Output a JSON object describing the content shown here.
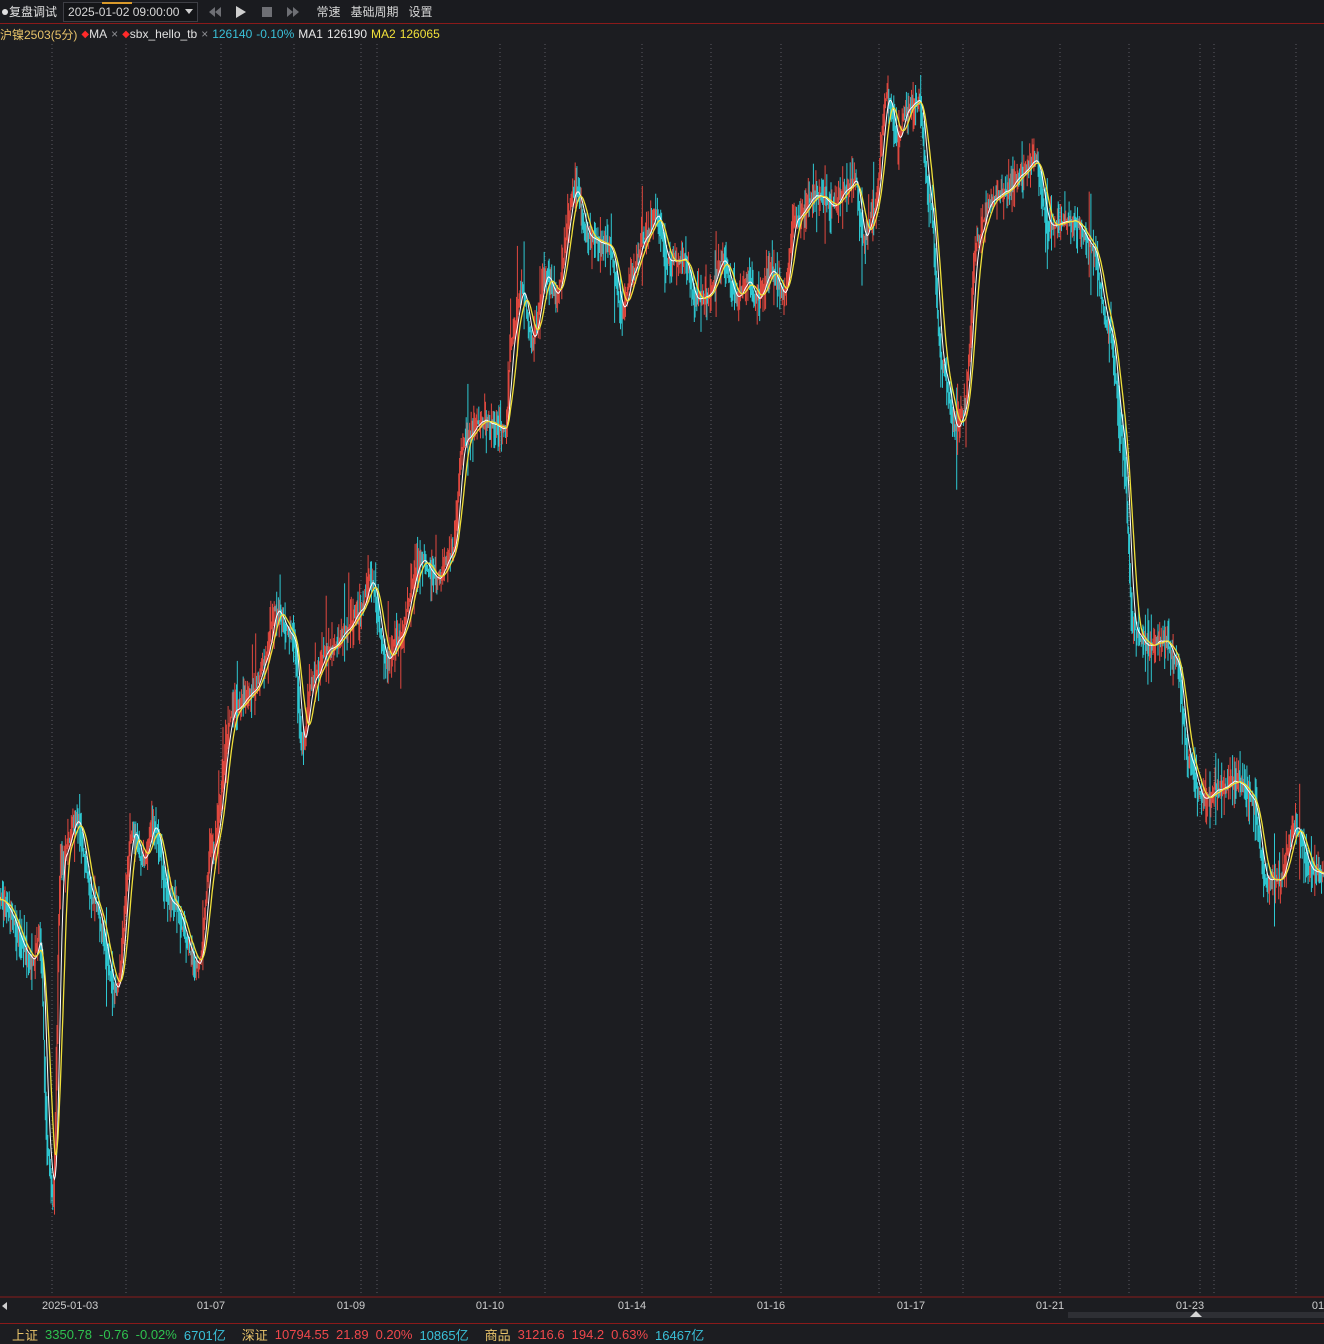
{
  "toolbar": {
    "title": "复盘调试",
    "datetime": "2025-01-02 09:00:00",
    "speed_label": "常速",
    "period_label": "基础周期",
    "settings_label": "设置"
  },
  "legend": {
    "symbol": "沪镍2503(5分)",
    "indicator1": "MA",
    "indicator2": "sbx_hello_tb",
    "close_symbol": "×",
    "price": "126140",
    "change_pct": "-0.10%",
    "ma1_label": "MA1",
    "ma1_value": "126190",
    "ma2_label": "MA2",
    "ma2_value": "126065"
  },
  "colors": {
    "up": "#e0483f",
    "down": "#2ec8d2",
    "ma1": "#ffffff",
    "ma2": "#f0e03a",
    "grid": "#5b5c62",
    "status_green": "#2fc24f",
    "status_red": "#f0484c",
    "status_cyan": "#3ac0d8"
  },
  "xaxis": {
    "ticks": [
      {
        "label": "2025-01-03",
        "at": 0.032
      },
      {
        "label": "01-07",
        "at": 0.159
      },
      {
        "label": "01-09",
        "at": 0.265
      },
      {
        "label": "01-10",
        "at": 0.37
      },
      {
        "label": "01-14",
        "at": 0.477
      },
      {
        "label": "01-16",
        "at": 0.582
      },
      {
        "label": "01-17",
        "at": 0.688
      },
      {
        "label": "01-21",
        "at": 0.793
      },
      {
        "label": "01-23",
        "at": 0.899
      },
      {
        "label": "01",
        "at": 1.0
      }
    ]
  },
  "chart_data": {
    "type": "line",
    "bars": 1580,
    "series": [
      {
        "anchors": [
          [
            0.0,
            900
          ],
          [
            0.025,
            960
          ],
          [
            0.03,
            935
          ],
          [
            0.036,
            1150
          ],
          [
            0.04,
            1200
          ],
          [
            0.046,
            860
          ],
          [
            0.058,
            820
          ],
          [
            0.07,
            900
          ],
          [
            0.088,
            990
          ],
          [
            0.1,
            830
          ],
          [
            0.108,
            860
          ],
          [
            0.116,
            825
          ],
          [
            0.128,
            900
          ],
          [
            0.15,
            965
          ],
          [
            0.16,
            850
          ],
          [
            0.176,
            710
          ],
          [
            0.192,
            690
          ],
          [
            0.2,
            660
          ],
          [
            0.208,
            610
          ],
          [
            0.222,
            640
          ],
          [
            0.228,
            745
          ],
          [
            0.236,
            680
          ],
          [
            0.248,
            650
          ],
          [
            0.262,
            630
          ],
          [
            0.272,
            610
          ],
          [
            0.28,
            580
          ],
          [
            0.292,
            660
          ],
          [
            0.3,
            640
          ],
          [
            0.318,
            560
          ],
          [
            0.33,
            580
          ],
          [
            0.342,
            550
          ],
          [
            0.35,
            440
          ],
          [
            0.364,
            420
          ],
          [
            0.382,
            430
          ],
          [
            0.386,
            340
          ],
          [
            0.394,
            290
          ],
          [
            0.402,
            340
          ],
          [
            0.412,
            275
          ],
          [
            0.42,
            295
          ],
          [
            0.434,
            190
          ],
          [
            0.446,
            240
          ],
          [
            0.46,
            245
          ],
          [
            0.47,
            310
          ],
          [
            0.478,
            270
          ],
          [
            0.486,
            240
          ],
          [
            0.496,
            215
          ],
          [
            0.504,
            262
          ],
          [
            0.516,
            260
          ],
          [
            0.526,
            300
          ],
          [
            0.534,
            295
          ],
          [
            0.546,
            260
          ],
          [
            0.556,
            300
          ],
          [
            0.564,
            280
          ],
          [
            0.572,
            300
          ],
          [
            0.582,
            270
          ],
          [
            0.592,
            295
          ],
          [
            0.6,
            220
          ],
          [
            0.616,
            195
          ],
          [
            0.63,
            205
          ],
          [
            0.638,
            190
          ],
          [
            0.646,
            180
          ],
          [
            0.652,
            240
          ],
          [
            0.66,
            210
          ],
          [
            0.67,
            95
          ],
          [
            0.678,
            140
          ],
          [
            0.684,
            110
          ],
          [
            0.694,
            100
          ],
          [
            0.702,
            200
          ],
          [
            0.712,
            370
          ],
          [
            0.722,
            430
          ],
          [
            0.728,
            410
          ],
          [
            0.738,
            240
          ],
          [
            0.748,
            200
          ],
          [
            0.76,
            190
          ],
          [
            0.77,
            175
          ],
          [
            0.782,
            160
          ],
          [
            0.792,
            225
          ],
          [
            0.81,
            220
          ],
          [
            0.824,
            245
          ],
          [
            0.838,
            330
          ],
          [
            0.848,
            440
          ],
          [
            0.856,
            630
          ],
          [
            0.866,
            645
          ],
          [
            0.88,
            640
          ],
          [
            0.888,
            660
          ],
          [
            0.898,
            760
          ],
          [
            0.908,
            800
          ],
          [
            0.92,
            790
          ],
          [
            0.934,
            780
          ],
          [
            0.946,
            800
          ],
          [
            0.956,
            880
          ],
          [
            0.966,
            880
          ],
          [
            0.978,
            825
          ],
          [
            0.99,
            870
          ],
          [
            1.0,
            875
          ]
        ]
      }
    ]
  },
  "status": {
    "sh": {
      "name": "上证",
      "value": "3350.78",
      "change": "-0.76",
      "pct": "-0.02%",
      "amount": "6701亿"
    },
    "sz": {
      "name": "深证",
      "value": "10794.55",
      "change": "21.89",
      "pct": "0.20%",
      "amount": "10865亿"
    },
    "cm": {
      "name": "商品",
      "value": "31216.6",
      "change": "194.2",
      "pct": "0.63%",
      "amount": "16467亿"
    }
  }
}
